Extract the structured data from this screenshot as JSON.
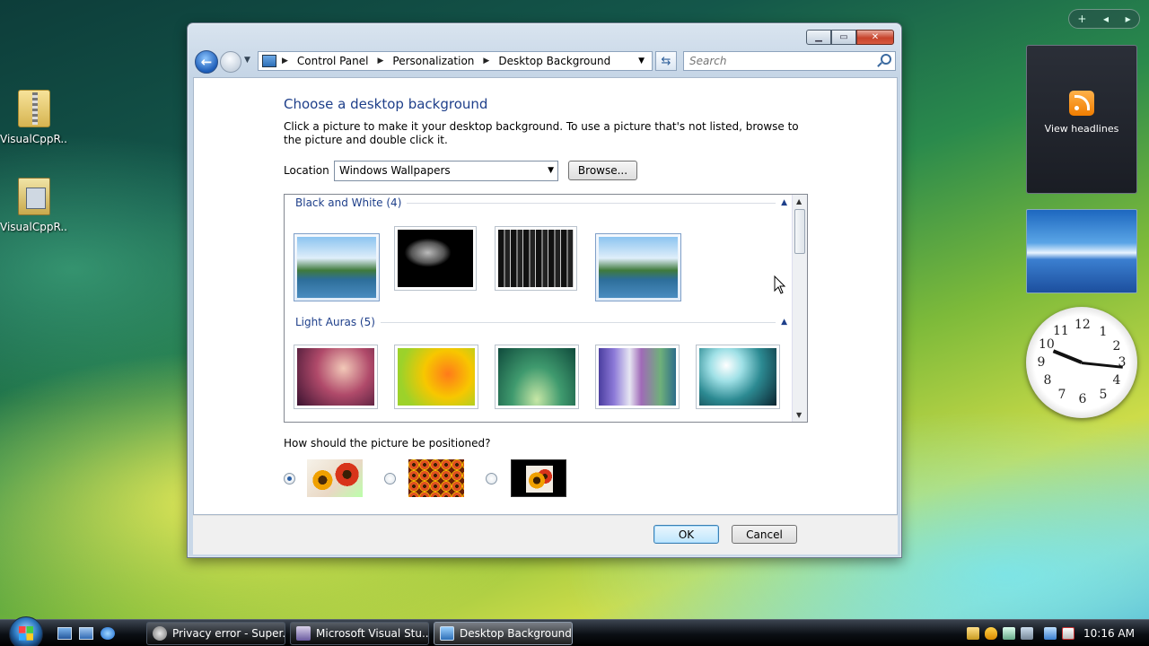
{
  "desktop": {
    "icons": [
      {
        "label": "VisualCppR..."
      },
      {
        "label": "VisualCppR..."
      }
    ]
  },
  "sidebar": {
    "feed_caption": "View headlines",
    "clock_numbers": [
      "12",
      "1",
      "2",
      "3",
      "4",
      "5",
      "6",
      "7",
      "8",
      "9",
      "10",
      "11"
    ]
  },
  "window": {
    "breadcrumbs": [
      "Control Panel",
      "Personalization",
      "Desktop Background"
    ],
    "search_placeholder": "Search",
    "heading": "Choose a desktop background",
    "intro": "Click a picture to make it your desktop background. To use a picture that's not listed, browse to the picture and double click it.",
    "location_label": "Location",
    "location_value": "Windows Wallpapers",
    "browse_label": "Browse...",
    "groups": [
      {
        "title": "Black and White (4)"
      },
      {
        "title": "Light Auras (5)"
      }
    ],
    "position_question": "How should the picture be positioned?",
    "ok_label": "OK",
    "cancel_label": "Cancel"
  },
  "taskbar": {
    "buttons": [
      {
        "label": "Privacy error - Super..."
      },
      {
        "label": "Microsoft Visual Stu..."
      },
      {
        "label": "Desktop Background"
      }
    ],
    "clock": "10:16 AM"
  }
}
